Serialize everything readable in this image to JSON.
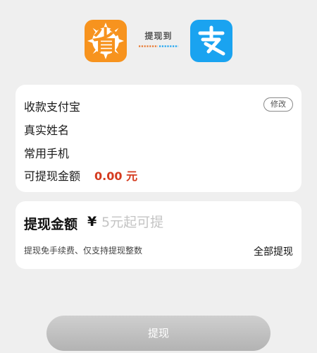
{
  "header": {
    "app_icon": "app-logo-icon",
    "app_logo_glyph": "省",
    "transfer_label": "提现到",
    "alipay_icon": "alipay-logo-icon",
    "colors": {
      "app_orange": "#f7931e",
      "alipay_blue": "#1aa3f0",
      "line_orange": "#e8772e",
      "line_blue": "#1aa3f0"
    }
  },
  "account_info": {
    "account_label": "收款支付宝",
    "edit_label": "修改",
    "name_label": "真实姓名",
    "phone_label": "常用手机",
    "available_label": "可提现金额",
    "available_value": "0.00 元",
    "colors": {
      "amount_red": "#d53b1f"
    }
  },
  "withdraw": {
    "title": "提现金额",
    "currency_symbol": "¥",
    "amount_value": "",
    "amount_placeholder": "5元起可提",
    "hint": "提现免手续费、仅支持提现整数",
    "withdraw_all_label": "全部提现"
  },
  "submit": {
    "label": "提现",
    "colors": {
      "disabled_gray": "#bfbfbf"
    }
  }
}
